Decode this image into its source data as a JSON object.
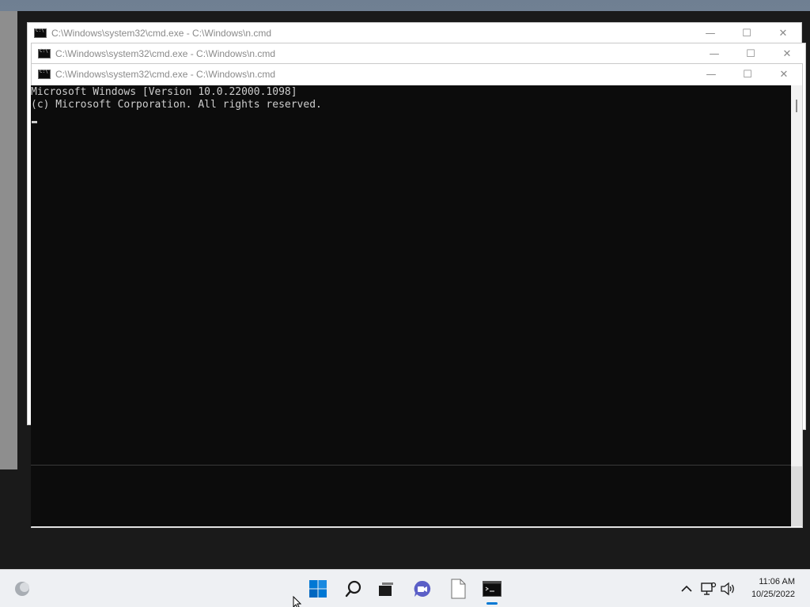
{
  "windows": [
    {
      "title": "C:\\Windows\\system32\\cmd.exe - C:\\Windows\\n.cmd"
    },
    {
      "title": "C:\\Windows\\system32\\cmd.exe - C:\\Windows\\n.cmd"
    },
    {
      "title": "C:\\Windows\\system32\\cmd.exe - C:\\Windows\\n.cmd"
    }
  ],
  "window_buttons": {
    "minimize": "—",
    "maximize": "☐",
    "close": "✕"
  },
  "console": {
    "lines": [
      "Microsoft Windows [Version 10.0.22000.1098]",
      "(c) Microsoft Corporation. All rights reserved."
    ]
  },
  "taskbar": {
    "icons": [
      "weather-icon",
      "start-icon",
      "search-icon",
      "task-view-icon",
      "chat-icon",
      "file-icon",
      "cmd-icon"
    ],
    "tray": {
      "time": "11:06 AM",
      "date": "10/25/2022"
    }
  },
  "colors": {
    "console_bg": "#0c0c0c",
    "console_text": "#cccccc",
    "accent": "#0078d4"
  }
}
